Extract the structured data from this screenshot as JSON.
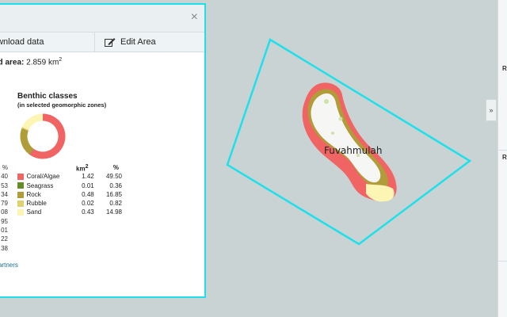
{
  "panel": {
    "close_glyph": "×",
    "download_label": "ownload data",
    "edit_label": "Edit Area",
    "area_label": "ed area:",
    "area_value": "2.859 km",
    "area_unit_sup": "2",
    "benthic_title": "Benthic classes",
    "benthic_subtitle": "(in selected geomorphic zones)",
    "left_column_header": "%",
    "left_column_values": [
      "40",
      "53",
      "34",
      "79",
      "08",
      "95",
      "01",
      "22",
      "38"
    ],
    "col_km_label": "km",
    "col_km_sup": "2",
    "col_pct_label": "%",
    "partners_label": "ch Partners"
  },
  "benthic_classes": [
    {
      "name": "Coral/Algae",
      "km2": "1.42",
      "pct": "49.50",
      "color": "#f06464"
    },
    {
      "name": "Seagrass",
      "km2": "0.01",
      "pct": "0.36",
      "color": "#668c2a"
    },
    {
      "name": "Rock",
      "km2": "0.48",
      "pct": "16.85",
      "color": "#b19c3a"
    },
    {
      "name": "Rubble",
      "km2": "0.02",
      "pct": "0.82",
      "color": "#e0d06e"
    },
    {
      "name": "Sand",
      "km2": "0.43",
      "pct": "14.98",
      "color": "#fdf5b4"
    }
  ],
  "map": {
    "island_label": "Fuvahmulah",
    "selection_color": "#1ee0ea"
  },
  "right_panel": {
    "expand_glyph": "»",
    "row1_label": "R",
    "row2_label": "R"
  }
}
